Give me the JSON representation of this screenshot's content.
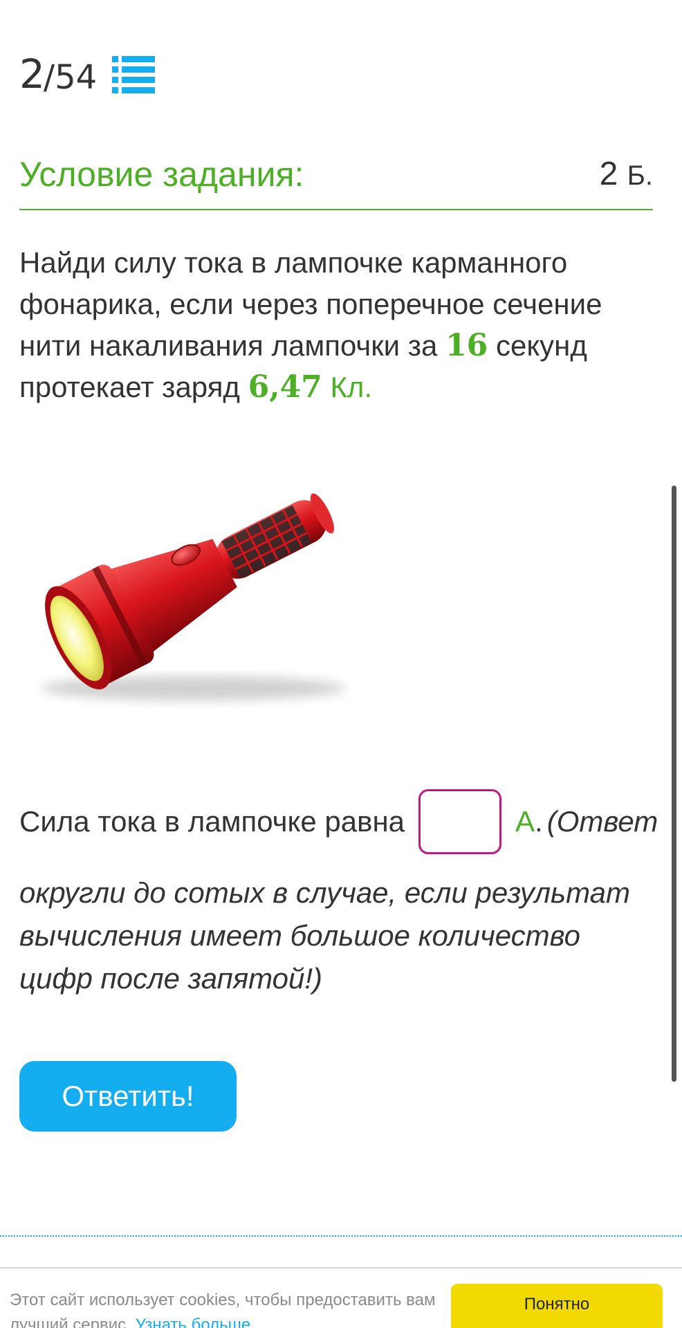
{
  "counter": {
    "current": "2",
    "separator": "/",
    "total": "54",
    "list_icon": "list-icon"
  },
  "task": {
    "title": "Условие задания:",
    "points_value": "2",
    "points_unit": "Б."
  },
  "problem": {
    "text_part1": "Найди силу тока в лампочке карманного фонарика, если через поперечное сечение нити накаливания лампочки за ",
    "time_value": "16",
    "text_part2": " секунд протекает заряд ",
    "charge_value": "6,47",
    "charge_unit": "Кл",
    "text_part3": "."
  },
  "image": {
    "subject": "flashlight-image"
  },
  "answer": {
    "prompt": "Сила тока в лампочке равна",
    "value": "",
    "unit": "А",
    "unit_suffix": ".",
    "hint_start": "(Ответ",
    "hint_rest": "округли до сотых в случае, если результат вычисления имеет большое количество цифр после запятой!)"
  },
  "submit": {
    "label": "Ответить!"
  },
  "cookie": {
    "text": "Этот сайт использует cookies, чтобы предоставить вам лучший сервис. ",
    "link": "Узнать больше",
    "accept": "Понятно"
  },
  "colors": {
    "accent_green": "#4caf25",
    "accent_blue": "#14aef0",
    "answer_border": "#c2187f",
    "cookie_button": "#f2d900"
  }
}
